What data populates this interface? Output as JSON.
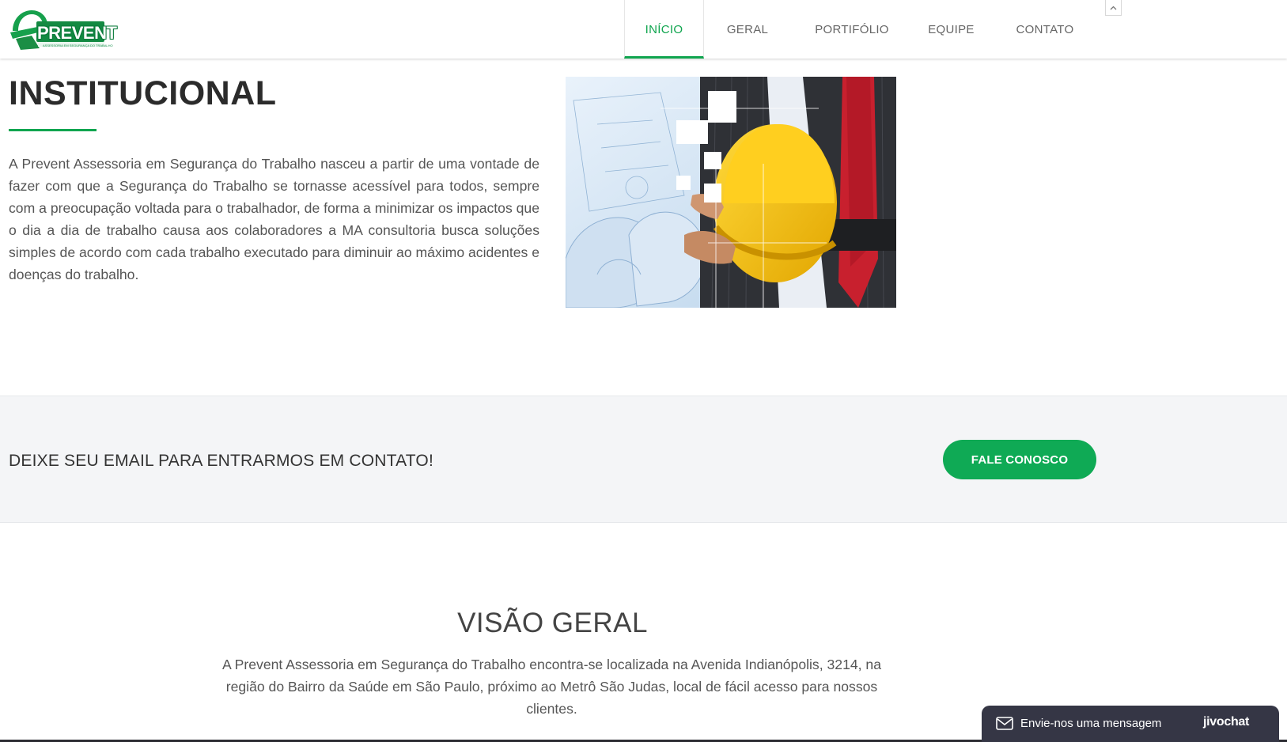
{
  "header": {
    "logo_text": "PREVENT",
    "logo_subtitle": "ASSESSORIA EM SEGURANÇA DO TRABALHO",
    "nav": [
      {
        "label": "INÍCIO",
        "active": true
      },
      {
        "label": "GERAL",
        "active": false
      },
      {
        "label": "PORTIFÓLIO",
        "active": false
      },
      {
        "label": "EQUIPE",
        "active": false
      },
      {
        "label": "CONTATO",
        "active": false
      }
    ],
    "scroll_top_icon": "chevron-up-icon"
  },
  "institucional": {
    "title": "INSTITUCIONAL",
    "text": "A Prevent Assessoria em Segurança do Trabalho nasceu a partir de uma vontade de fazer com que a Segurança do Trabalho se tornasse acessível para todos, sempre com a preocupação voltada para o trabalhador, de forma a minimizar os impactos que o dia a dia de trabalho causa aos colaboradores a MA consultoria busca soluções simples de acordo com cada trabalho executado para diminuir ao máximo acidentes e doenças do trabalho."
  },
  "contact_band": {
    "text": "DEIXE SEU EMAIL PARA ENTRARMOS EM CONTATO!",
    "button_label": "FALE CONOSCO"
  },
  "visao_geral": {
    "title": "VISÃO GERAL",
    "text": "A Prevent Assessoria em Segurança do Trabalho encontra-se localizada na Avenida Indianópolis, 3214, na região do Bairro da Saúde em São Paulo, próximo ao Metrô São Judas, local de fácil acesso para nossos clientes."
  },
  "chat_widget": {
    "label": "Envie-nos uma mensagem",
    "brand": "jivochat",
    "icon": "envelope-icon"
  },
  "colors": {
    "brand_green": "#10a54f",
    "button_green": "#0faa55",
    "band_background": "#f4f5f7",
    "chat_background": "#353645"
  }
}
